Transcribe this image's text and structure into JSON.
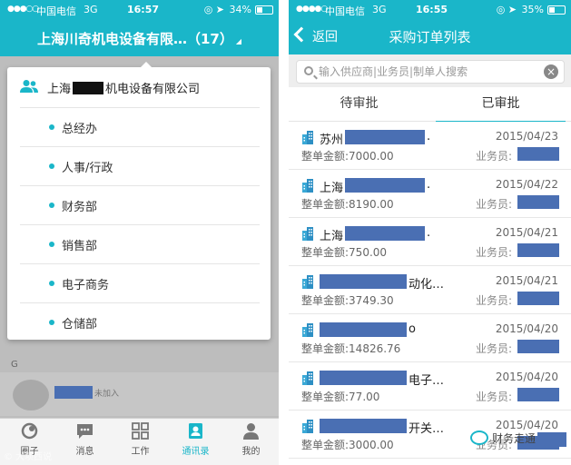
{
  "left": {
    "statusbar": {
      "signal": "●●●○○",
      "carrier": "中国电信",
      "network": "3G",
      "time": "16:57",
      "icons": "◎ ➤",
      "battery": "34%",
      "battery_level": 0.34
    },
    "title": "上海川奇机电设备有限…（17）",
    "dropdown": {
      "company_prefix": "上海",
      "company_suffix": "机电设备有限公司",
      "departments": [
        "总经办",
        "人事/行政",
        "财务部",
        "销售部",
        "电子商务",
        "仓储部"
      ]
    },
    "background": {
      "group_letter": "G",
      "badge": "未加入"
    },
    "bottom_nav": [
      {
        "label": "圈子",
        "icon": "circle-icon"
      },
      {
        "label": "消息",
        "icon": "message-icon"
      },
      {
        "label": "工作",
        "icon": "grid-icon"
      },
      {
        "label": "通讯录",
        "icon": "contacts-icon"
      },
      {
        "label": "我的",
        "icon": "person-icon"
      }
    ],
    "watermark": "© 大坝西说"
  },
  "right": {
    "statusbar": {
      "signal": "●●●●○",
      "carrier": "中国电信",
      "network": "3G",
      "time": "16:55",
      "icons": "◎ ➤",
      "battery": "35%",
      "battery_level": 0.35
    },
    "back_label": "返回",
    "title": "采购订单列表",
    "search": {
      "placeholder": "输入供应商|业务员|制单人搜索"
    },
    "tabs": [
      {
        "label": "待审批"
      },
      {
        "label": "已审批"
      }
    ],
    "orders": [
      {
        "vendor_prefix": "苏州",
        "vendor_tail": ".",
        "date": "2015/04/23",
        "amount": "整单金额:7000.00",
        "staff_label": "业务员:"
      },
      {
        "vendor_prefix": "上海",
        "vendor_tail": ".",
        "date": "2015/04/22",
        "amount": "整单金额:8190.00",
        "staff_label": "业务员:"
      },
      {
        "vendor_prefix": "上海",
        "vendor_tail": ".",
        "date": "2015/04/21",
        "amount": "整单金额:750.00",
        "staff_label": "业务员:"
      },
      {
        "vendor_prefix": "",
        "vendor_tail": "动化…",
        "date": "2015/04/21",
        "amount": "整单金额:3749.30",
        "staff_label": "业务员:"
      },
      {
        "vendor_prefix": "",
        "vendor_tail": "o",
        "date": "2015/04/20",
        "amount": "整单金额:14826.76",
        "staff_label": "业务员:"
      },
      {
        "vendor_prefix": "",
        "vendor_tail": "电子…",
        "date": "2015/04/20",
        "amount": "整单金额:77.00",
        "staff_label": "业务员:"
      },
      {
        "vendor_prefix": "",
        "vendor_tail": "开关…",
        "date": "2015/04/20",
        "amount": "整单金额:3000.00",
        "staff_label": "业务员:"
      }
    ],
    "wechat_watermark": "财务走通"
  },
  "colors": {
    "accent": "#1ab6c9",
    "redaction": "#4a6fb3"
  }
}
